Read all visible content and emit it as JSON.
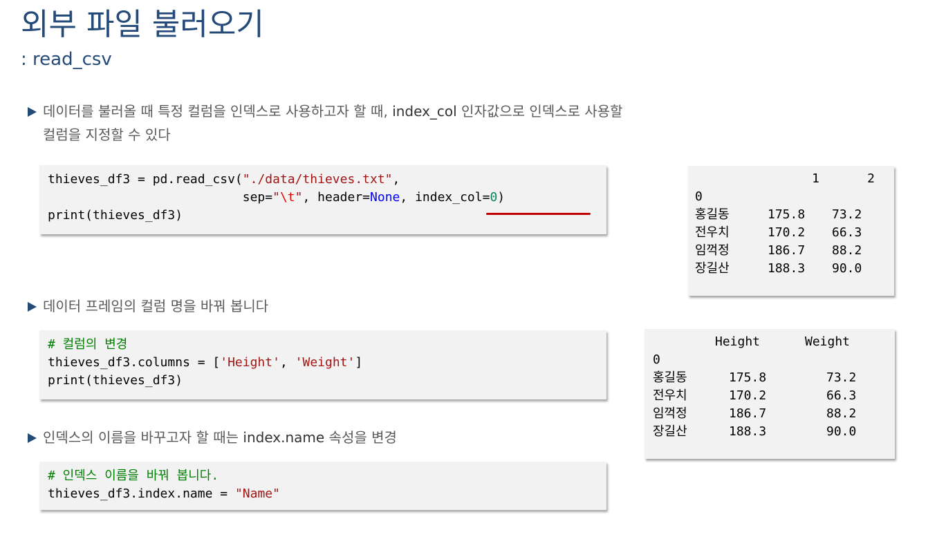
{
  "header": {
    "title": "외부 파일 불러오기",
    "subtitle": ": read_csv"
  },
  "bullets": [
    {
      "text_line1_pre": "데이터를 불러올 때 특정 컬럼을 인덱스로 사용하고자 할 때, ",
      "text_line1_key": "index_col",
      "text_line1_post": " 인자값으로 인덱스로 사용할",
      "text_line2": "컬럼을 지정할 수 있다"
    },
    {
      "text": "데이터 프레임의 컬럼 명을 바꿔 봅니다"
    },
    {
      "text_pre": "인덱스의 이름을 바꾸고자 할 때는 ",
      "text_key": "index.name",
      "text_post": " 속성을 변경"
    }
  ],
  "code1": {
    "line1_a": "thieves_df3 = pd.read_csv(",
    "line1_str": "\"./data/thieves.txt\"",
    "line1_b": ",",
    "line2_pad": "                          sep=",
    "line2_q1": "\"",
    "line2_esc": "\\t",
    "line2_q2": "\"",
    "line2_a": ", header=",
    "line2_none": "None",
    "line2_b": ", index_col=",
    "line2_num": "0",
    "line2_c": ")",
    "line3": "print(thieves_df3)"
  },
  "code2": {
    "comment": "# 컬럼의 변경",
    "line2_a": "thieves_df3.columns = [",
    "line2_s1": "'Height'",
    "line2_b": ", ",
    "line2_s2": "'Weight'",
    "line2_c": "]",
    "line3": "print(thieves_df3)"
  },
  "code3": {
    "comment": "# 인덱스 이름을 바꿔 봅니다.",
    "line2_a": "thieves_df3.index.name = ",
    "line2_str": "\"Name\""
  },
  "output1": {
    "columns": [
      "1",
      "2"
    ],
    "index_name": "0",
    "rows": [
      {
        "name": "홍길동",
        "c1": "175.8",
        "c2": "73.2"
      },
      {
        "name": "전우치",
        "c1": "170.2",
        "c2": "66.3"
      },
      {
        "name": "임꺽정",
        "c1": "186.7",
        "c2": "88.2"
      },
      {
        "name": "장길산",
        "c1": "188.3",
        "c2": "90.0"
      }
    ]
  },
  "output2": {
    "columns": [
      "Height",
      "Weight"
    ],
    "index_name": "0",
    "rows": [
      {
        "name": "홍길동",
        "c1": "175.8",
        "c2": "73.2"
      },
      {
        "name": "전우치",
        "c1": "170.2",
        "c2": "66.3"
      },
      {
        "name": "임꺽정",
        "c1": "186.7",
        "c2": "88.2"
      },
      {
        "name": "장길산",
        "c1": "188.3",
        "c2": "90.0"
      }
    ]
  },
  "colors": {
    "title": "#244a7a",
    "body_text": "#595959",
    "underline": "#c00000",
    "code_bg": "#f2f2f2"
  }
}
